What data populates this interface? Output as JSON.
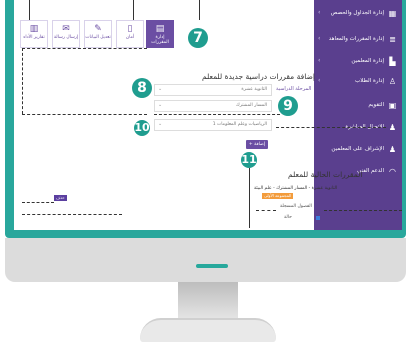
{
  "sidebar": {
    "items": [
      {
        "label": "إدارة الجداول والحصص",
        "icon": "calendar-icon",
        "chevron": "‹"
      },
      {
        "label": "إدارة المقررات والمعاهد",
        "icon": "layers-icon",
        "chevron": "‹"
      },
      {
        "label": "إدارة المعلمين",
        "icon": "teacher-icon",
        "chevron": "‹"
      },
      {
        "label": "إدارة الطلاب",
        "icon": "students-icon",
        "chevron": "‹"
      },
      {
        "label": "التقويم",
        "icon": "calendar-grid-icon",
        "chevron": ""
      },
      {
        "label": "الاتصال المباشرة",
        "icon": "live-icon",
        "chevron": ""
      },
      {
        "label": "الإشراف على المعلمين",
        "icon": "supervisor-icon",
        "chevron": ""
      },
      {
        "label": "الدعم الفني",
        "icon": "headset-icon",
        "chevron": ""
      }
    ]
  },
  "toolbar": {
    "buttons": [
      {
        "label": "إدارة المقررات",
        "icon": "book-icon"
      },
      {
        "label": "أمان",
        "icon": "document-icon"
      },
      {
        "label": "تعديل البيانات",
        "icon": "pencil-icon"
      },
      {
        "label": "إرسال رسالة",
        "icon": "mail-icon"
      },
      {
        "label": "تقارير الأداء",
        "icon": "bar-chart-icon"
      }
    ]
  },
  "callouts": {
    "n7": "7",
    "n8": "8",
    "n9": "9",
    "n10": "10",
    "n11": "11"
  },
  "form": {
    "heading": "إضافة مقررات دراسية جديدة للمعلم",
    "stage_label": "المرحلة الدراسية",
    "stage_value": "الثانوية عشرة",
    "track_value": "المسار المشترك",
    "subject_value": "الرياضيات وعلم المعلومات 1",
    "add_button": "+ إضافة"
  },
  "list": {
    "heading": "المقررات الحالية للمعلم",
    "item_title": "الثانوية عشرة - المسار المشترك - علم البيئة",
    "badge": "المجموعة الأولى",
    "sub_label": "الفصول المسجلة",
    "check_label": "حالة",
    "delete_button": "حذف"
  },
  "colors": {
    "teal": "#29a79c",
    "purple": "#5a3f8e",
    "accent": "#6b4ea3"
  }
}
